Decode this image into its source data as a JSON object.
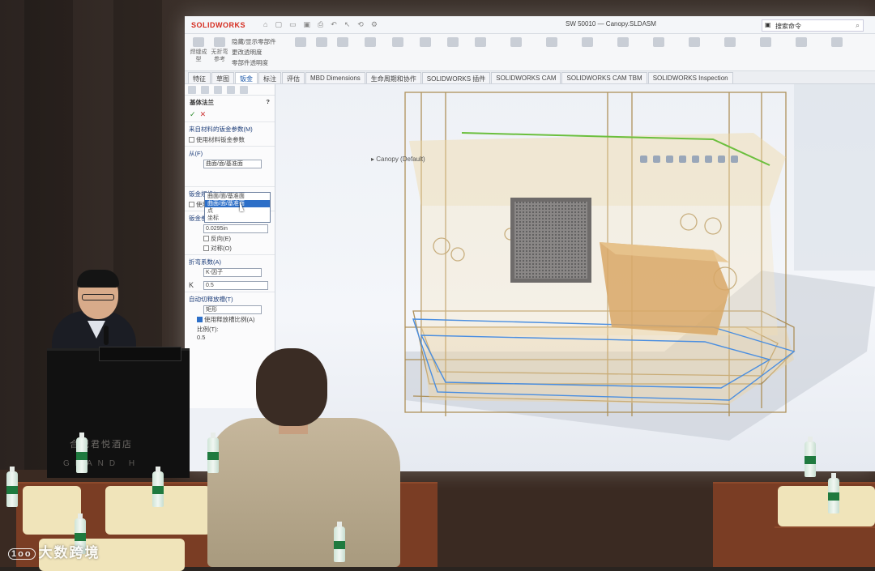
{
  "app": {
    "brand": "SOLIDWORKS",
    "doc_title": "SW 50010 — Canopy.SLDASM",
    "search_placeholder": "搜索命令"
  },
  "ribbon": {
    "buttons": [
      "焊缝成型",
      "无折弯",
      "参考"
    ],
    "text_items": [
      "隐藏/显示零部件",
      "更改透明度",
      "零部件透明度"
    ]
  },
  "tabs": [
    "特征",
    "草图",
    "钣金",
    "标注",
    "评估",
    "MBD Dimensions",
    "生命周期和协作",
    "SOLIDWORKS 插件",
    "SOLIDWORKS CAM",
    "SOLIDWORKS CAM TBM",
    "SOLIDWORKS Inspection"
  ],
  "tabs_active_index": 2,
  "property_manager": {
    "title": "基体法兰",
    "material_group": "来自材料的钣金参数(M)",
    "material_check": "使用材料钣金参数",
    "from_group": "从(F)",
    "from_options": [
      "曲面/面/基准面",
      "曲面/面/基准面",
      "点",
      "坐标"
    ],
    "from_selected_index": 1,
    "gauge_group": "钣金规格(M)",
    "gauge_check": "使用规格表(G)",
    "params_group": "钣金参数(S)",
    "thickness": "0.0295in",
    "reverse": "反向(E)",
    "symmetric": "对称(O)",
    "bend_group": "折弯系数(A)",
    "bend_type": "K-因子",
    "k_label": "K",
    "k_value": "0.5",
    "relief_group": "自动切释放槽(T)",
    "relief_type": "矩形",
    "relief_check": "使用释放槽比例(A)",
    "ratio_label": "比例(T):",
    "ratio_value": "0.5"
  },
  "tree": {
    "root": "Canopy (Default)"
  },
  "podium": {
    "name": "合肥君悦酒店",
    "sub": "GRAND H"
  },
  "watermark": {
    "logo": "1oo",
    "text": "大数跨境"
  }
}
